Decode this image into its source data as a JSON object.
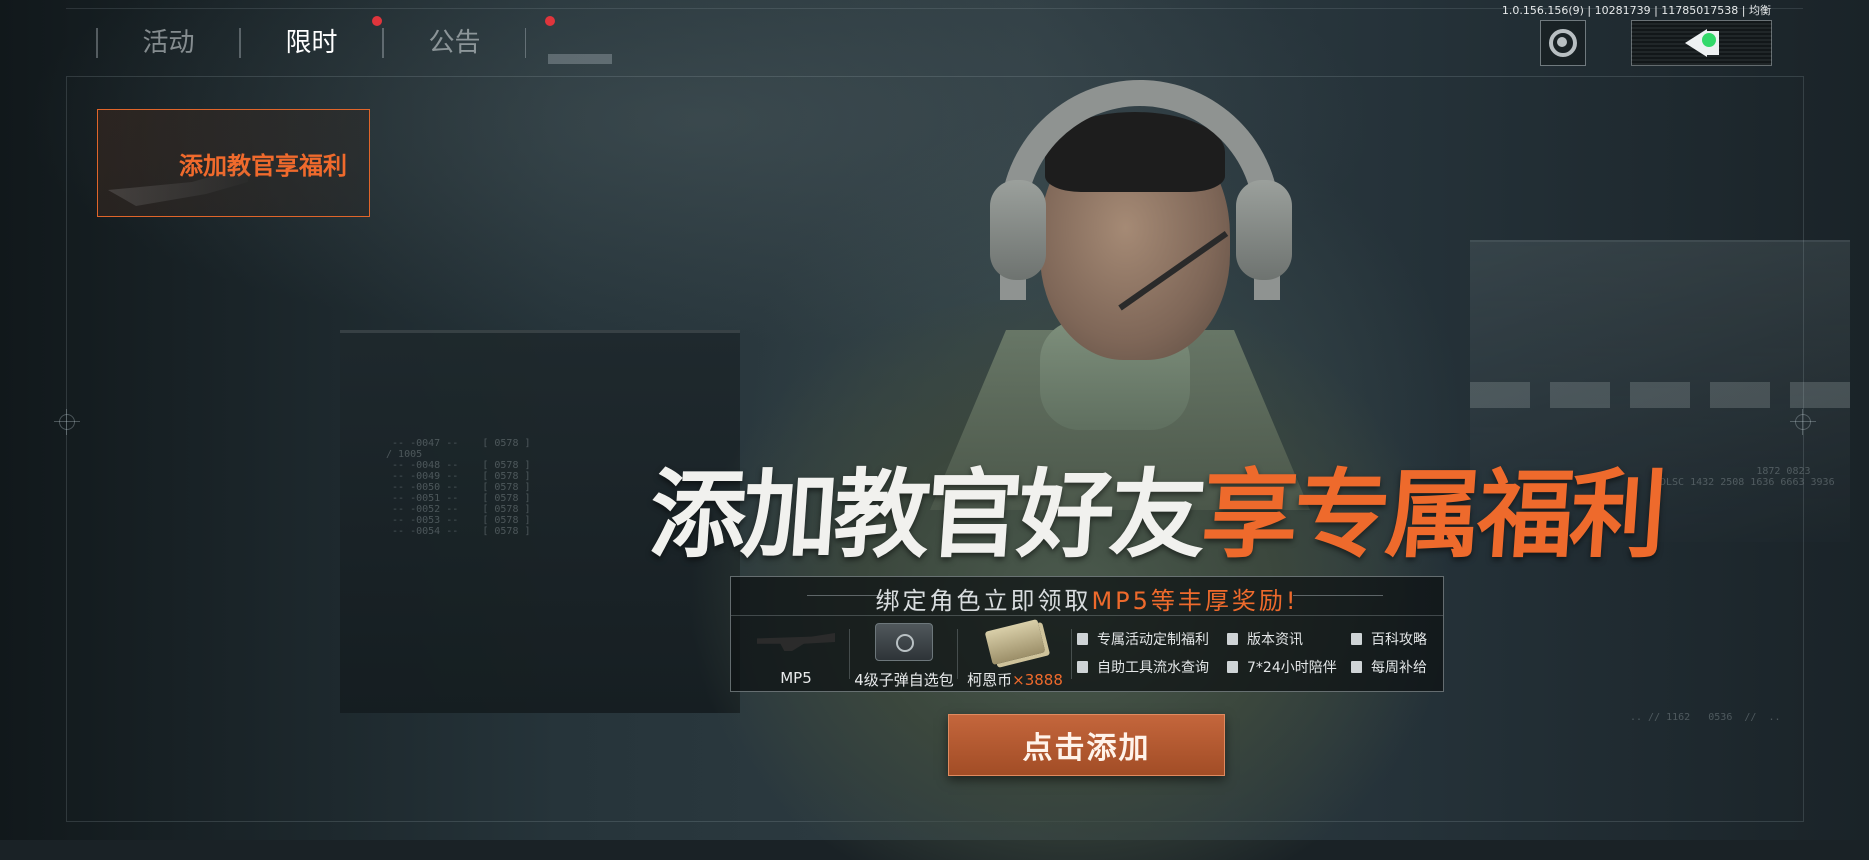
{
  "tabs": [
    {
      "label": "活动",
      "active": false,
      "badge": false
    },
    {
      "label": "限时",
      "active": true,
      "badge": true
    },
    {
      "label": "公告",
      "active": false,
      "badge": true
    }
  ],
  "version_info": "1.0.156.156(9) | 10281739 | 11785017538 | 均衡",
  "top_buttons": {
    "logo_icon": "game-logo-icon",
    "back_icon": "back-arrow-icon",
    "back_indicator_color": "#33d96a"
  },
  "side_card": {
    "label": "添加教官享福利"
  },
  "headline": {
    "white_part": "添加教官好友",
    "orange_part": "享专属福利"
  },
  "panel": {
    "subtitle_prefix": "绑定角色立即领取",
    "subtitle_highlight": "MP5等丰厚奖励!",
    "rewards": [
      {
        "label": "MP5",
        "icon": "mp5-gun-icon"
      },
      {
        "label": "4级子弹自选包",
        "icon": "ammo-box-icon"
      },
      {
        "label": "柯恩币",
        "multiplier": "×3888",
        "icon": "cash-stack-icon"
      }
    ],
    "features": [
      {
        "label": "专属活动定制福利",
        "icon": "gift-icon"
      },
      {
        "label": "版本资讯",
        "icon": "document-icon"
      },
      {
        "label": "百科攻略",
        "icon": "book-icon"
      },
      {
        "label": "自助工具流水查询",
        "icon": "receipt-icon"
      },
      {
        "label": "7*24小时陪伴",
        "icon": "people-icon"
      },
      {
        "label": "每周补给",
        "icon": "battery-icon"
      }
    ]
  },
  "cta": {
    "label": "点击添加"
  },
  "colors": {
    "accent": "#ee6a2c",
    "badge": "#e0353c"
  }
}
